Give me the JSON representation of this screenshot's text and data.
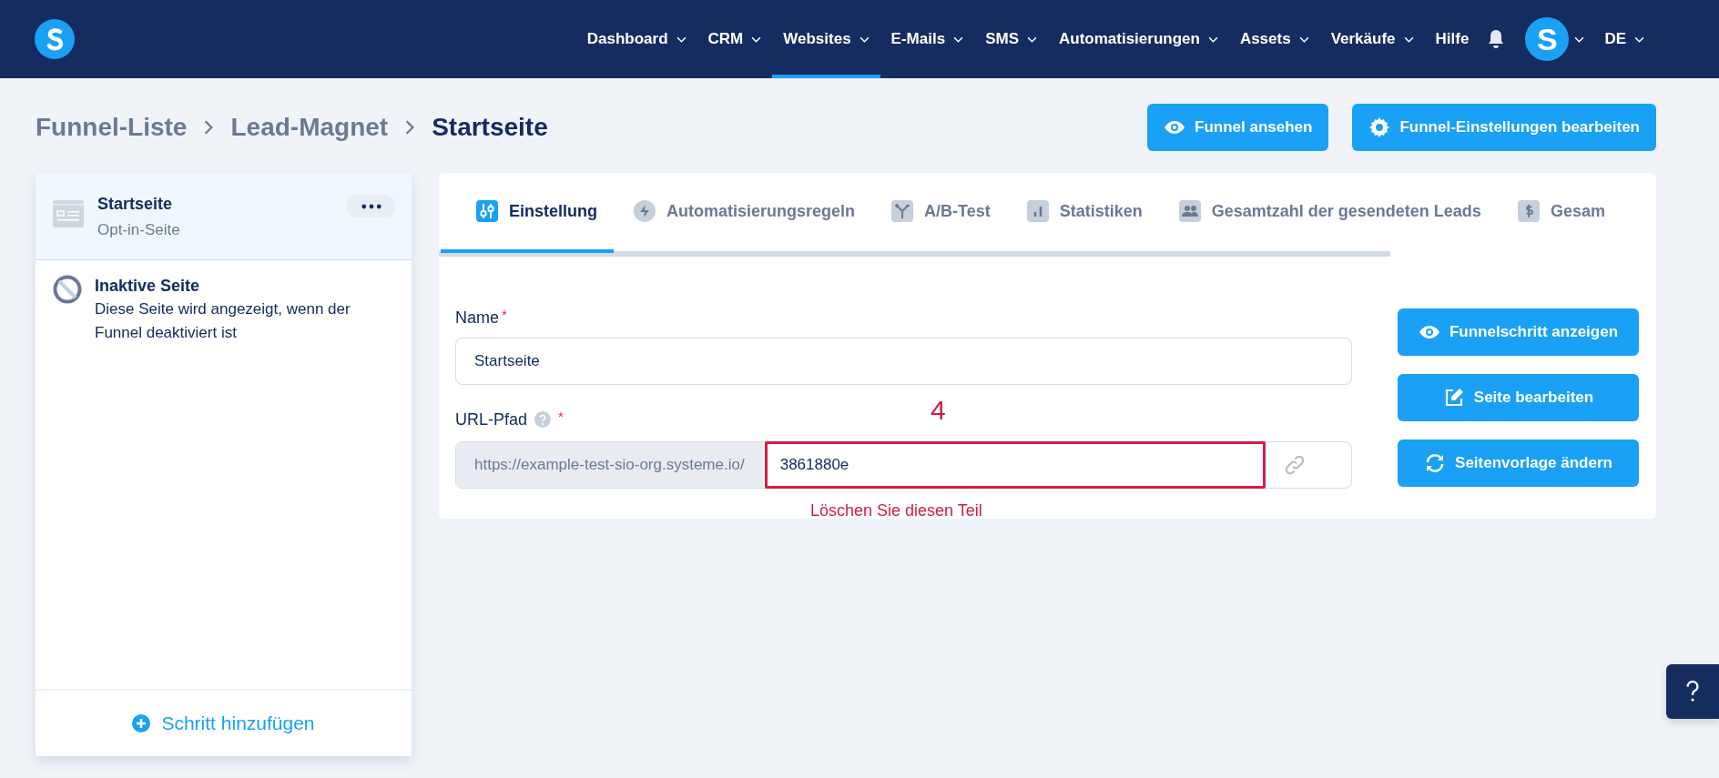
{
  "nav": {
    "items": [
      {
        "label": "Dashboard",
        "dropdown": true,
        "selected": false
      },
      {
        "label": "CRM",
        "dropdown": true,
        "selected": false
      },
      {
        "label": "Websites",
        "dropdown": true,
        "selected": true
      },
      {
        "label": "E-Mails",
        "dropdown": true,
        "selected": false
      },
      {
        "label": "SMS",
        "dropdown": true,
        "selected": false
      },
      {
        "label": "Automatisierungen",
        "dropdown": true,
        "selected": false
      },
      {
        "label": "Assets",
        "dropdown": true,
        "selected": false
      },
      {
        "label": "Verkäufe",
        "dropdown": true,
        "selected": false
      },
      {
        "label": "Hilfe",
        "dropdown": false,
        "selected": false
      }
    ],
    "avatar": "S",
    "language": "DE"
  },
  "breadcrumb": [
    {
      "label": "Funnel-Liste",
      "current": false
    },
    {
      "label": "Lead-Magnet",
      "current": false
    },
    {
      "label": "Startseite",
      "current": true
    }
  ],
  "header_buttons": [
    "Funnel ansehen",
    "Funnel-Einstellungen bearbeiten"
  ],
  "sidebar": {
    "steps": [
      {
        "title": "Startseite",
        "subtitle": "Opt-in-Seite",
        "selected": true
      }
    ],
    "inactive": {
      "title": "Inaktive Seite",
      "text": "Diese Seite wird angezeigt, wenn der Funnel deaktiviert ist"
    },
    "add_button": "Schritt hinzufügen"
  },
  "tabs": [
    {
      "label": "Einstellung",
      "selected": true
    },
    {
      "label": "Automatisierungsregeln",
      "selected": false
    },
    {
      "label": "A/B-Test",
      "selected": false
    },
    {
      "label": "Statistiken",
      "selected": false
    },
    {
      "label": "Gesamtzahl der gesendeten Leads",
      "selected": false
    },
    {
      "label": "Gesam",
      "selected": false
    }
  ],
  "form": {
    "name": {
      "label": "Name",
      "required_mark": "*",
      "value": "Startseite"
    },
    "url": {
      "label": "URL-Pfad",
      "required_mark": "*",
      "prefix": "https://example-test-sio-org.systeme.io/",
      "value": "3861880e"
    }
  },
  "side_buttons": [
    "Funnelschritt anzeigen",
    "Seite bearbeiten",
    "Seitenvorlage ändern"
  ],
  "annotation": {
    "number": "4",
    "note": "Löschen Sie diesen Teil"
  }
}
